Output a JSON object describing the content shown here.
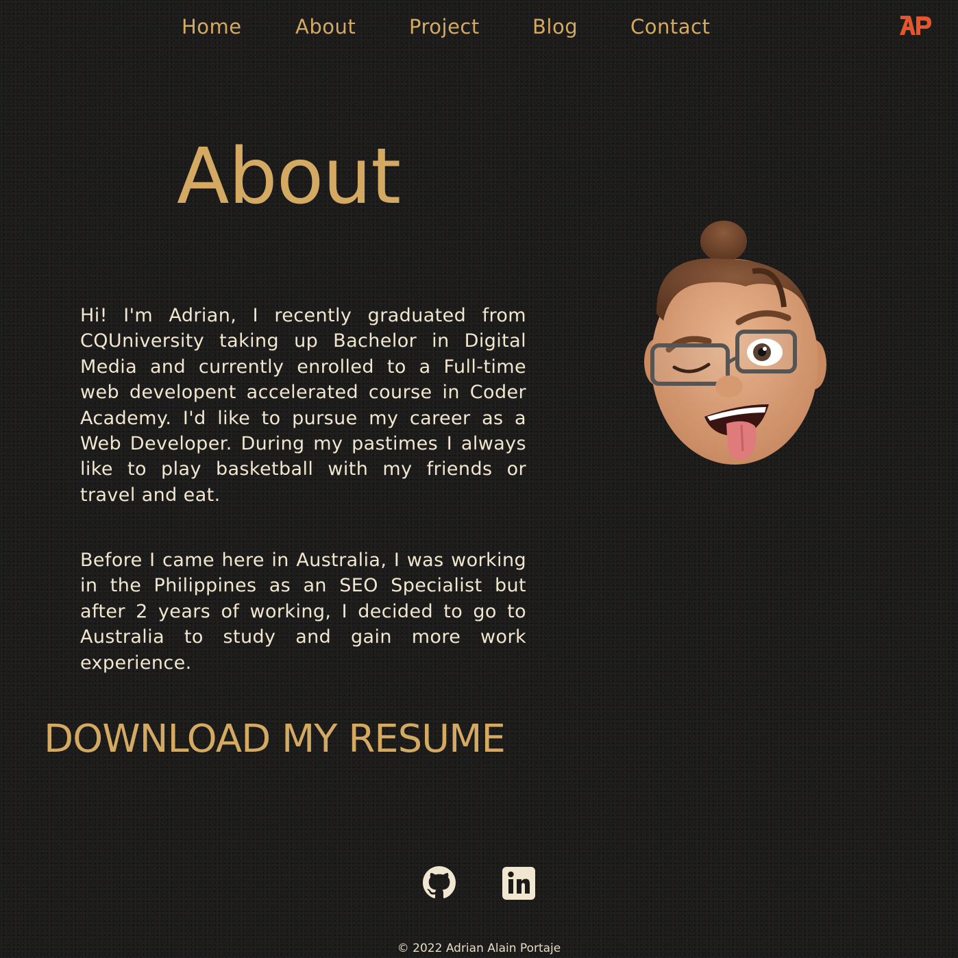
{
  "nav": {
    "items": [
      {
        "label": "Home"
      },
      {
        "label": "About"
      },
      {
        "label": "Project"
      },
      {
        "label": "Blog"
      },
      {
        "label": "Contact"
      }
    ],
    "logo_text": "AP",
    "logo_color": "#e4572e"
  },
  "about": {
    "title": "About",
    "paragraphs": [
      "Hi! I'm Adrian, I recently graduated from CQUniversity taking up Bachelor in Digital Media and currently enrolled to a Full-time web developent accelerated course in Coder Academy. I'd like to pursue my career as a Web Developer. During my pastimes I always like to play basketball with my friends or travel and eat.",
      "Before I came here in Australia, I was working in the Philippines as an SEO Specialist but after 2 years of working, I decided to go to Australia to study and gain more work experience."
    ],
    "resume_link": "DOWNLOAD MY RESUME",
    "avatar_icon": "memoji-avatar-winking"
  },
  "social": [
    {
      "icon": "github-icon"
    },
    {
      "icon": "linkedin-icon"
    }
  ],
  "footer": {
    "text": "© 2022 Adrian Alain Portaje"
  },
  "colors": {
    "background": "#1b1a19",
    "accent": "#d4aa63",
    "body_text": "#f1e6d0",
    "brand": "#e4572e"
  }
}
